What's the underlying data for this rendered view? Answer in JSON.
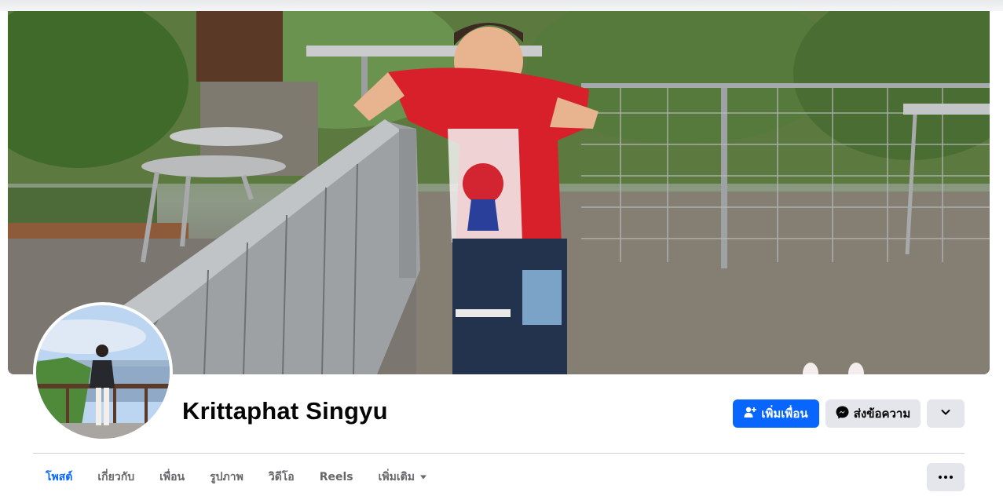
{
  "profile": {
    "name": "Krittaphat Singyu"
  },
  "actions": {
    "add_friend_label": "เพิ่มเพื่อน",
    "message_label": "ส่งข้อความ"
  },
  "tabs": [
    {
      "label": "โพสต์",
      "active": true
    },
    {
      "label": "เกี่ยวกับ",
      "active": false
    },
    {
      "label": "เพื่อน",
      "active": false
    },
    {
      "label": "รูปภาพ",
      "active": false
    },
    {
      "label": "วิดีโอ",
      "active": false
    },
    {
      "label": "Reels",
      "active": false
    },
    {
      "label": "เพิ่มเติม",
      "active": false
    }
  ],
  "icons": {
    "add_friend": "add-friend-icon",
    "messenger": "messenger-icon",
    "chevron": "chevron-down-icon",
    "more": "more-dots-icon"
  },
  "colors": {
    "accent": "#0866ff",
    "secondary_button": "#e4e6eb",
    "text": "#050505",
    "muted_text": "#65676b"
  }
}
